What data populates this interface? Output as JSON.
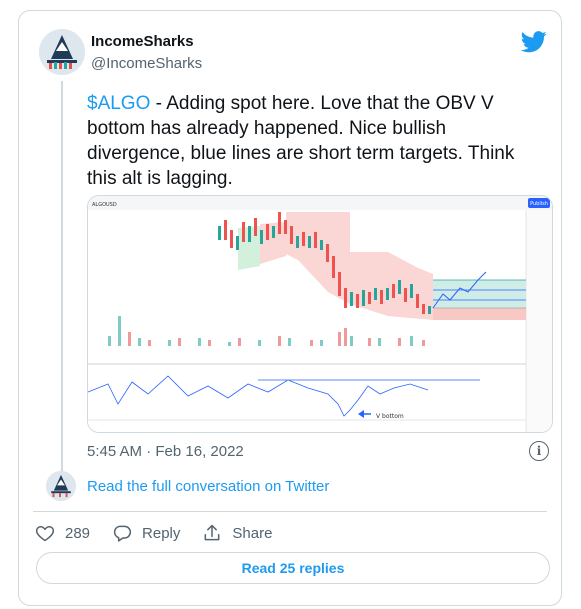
{
  "author": {
    "name": "IncomeSharks",
    "handle": "@IncomeSharks"
  },
  "tweet": {
    "cashtag": "$ALGO",
    "body": " - Adding spot here. Love that the OBV V bottom has already happened. Nice bullish divergence, blue lines are short term targets. Think this alt is lagging.",
    "timestamp": "5:45 AM · Feb 16, 2022"
  },
  "chart_image": {
    "symbol": "ALGOUSD",
    "publish_button": "Publish",
    "annotation": "V bottom"
  },
  "conversation_link": "Read the full conversation on Twitter",
  "actions": {
    "likes": "289",
    "reply_label": "Reply",
    "share_label": "Share"
  },
  "read_replies": "Read 25 replies",
  "colors": {
    "accent": "#1d9bf0",
    "text": "#0f1419",
    "muted": "#536471",
    "border": "#cfd9de"
  },
  "icons": [
    "twitter-bird-icon",
    "info-icon",
    "heart-icon",
    "reply-icon",
    "share-icon"
  ]
}
